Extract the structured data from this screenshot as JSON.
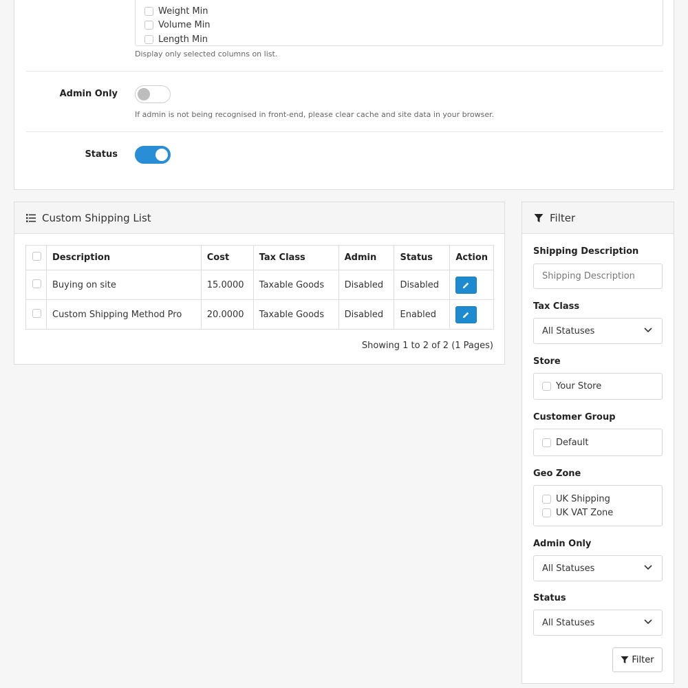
{
  "settings": {
    "columns_options": [
      {
        "label": "Weight Min",
        "checked": false
      },
      {
        "label": "Volume Min",
        "checked": false
      },
      {
        "label": "Length Min",
        "checked": false
      }
    ],
    "columns_help": "Display only selected columns on list.",
    "admin_only": {
      "label": "Admin Only",
      "on": false,
      "help": "If admin is not being recognised in front-end, please clear cache and site data in your browser."
    },
    "status": {
      "label": "Status",
      "on": true
    }
  },
  "list": {
    "title": "Custom Shipping List",
    "icon": "list-icon",
    "headers": [
      "Description",
      "Cost",
      "Tax Class",
      "Admin",
      "Status",
      "Action"
    ],
    "rows": [
      {
        "description": "Buying on site",
        "cost": "15.0000",
        "tax_class": "Taxable Goods",
        "admin": "Disabled",
        "status": "Disabled"
      },
      {
        "description": "Custom Shipping Method Pro",
        "cost": "20.0000",
        "tax_class": "Taxable Goods",
        "admin": "Disabled",
        "status": "Enabled"
      }
    ],
    "showing": "Showing 1 to 2 of 2 (1 Pages)"
  },
  "filter": {
    "title": "Filter",
    "icon": "filter-icon",
    "shipping_description": {
      "label": "Shipping Description",
      "placeholder": "Shipping Description"
    },
    "tax_class": {
      "label": "Tax Class",
      "value": "All Statuses"
    },
    "store": {
      "label": "Store",
      "options": [
        "Your Store"
      ]
    },
    "customer_group": {
      "label": "Customer Group",
      "options": [
        "Default"
      ]
    },
    "geo_zone": {
      "label": "Geo Zone",
      "options": [
        "UK Shipping",
        "UK VAT Zone"
      ]
    },
    "admin_only": {
      "label": "Admin Only",
      "value": "All Statuses"
    },
    "status": {
      "label": "Status",
      "value": "All Statuses"
    },
    "button_label": "Filter"
  },
  "colors": {
    "accent": "#2a8ed6",
    "edit_button": "#1e8bd0"
  }
}
